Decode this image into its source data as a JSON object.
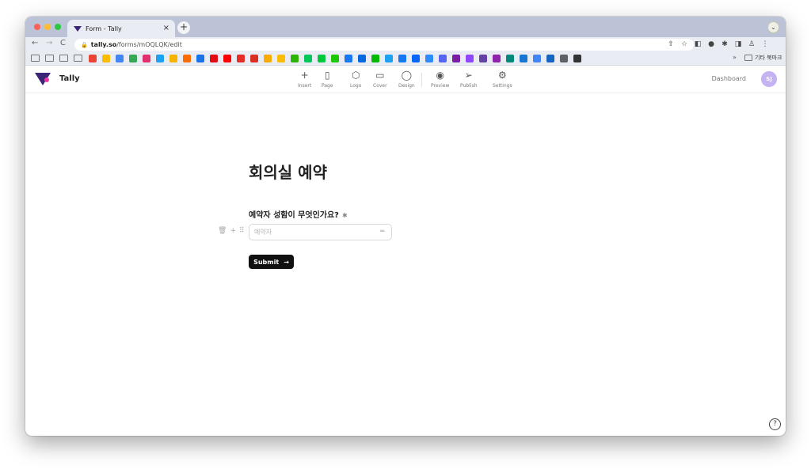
{
  "browser": {
    "tab": {
      "title": "Form - Tally",
      "close_glyph": "×"
    },
    "new_tab_glyph": "+",
    "profile_glyph": "⌄",
    "nav": {
      "back": "←",
      "forward": "→",
      "reload": "C"
    },
    "url": {
      "lock": "🔒",
      "domain": "tally.so",
      "path": "/forms/mOQLQK/edit"
    },
    "toolbar_icons": [
      {
        "name": "share-icon",
        "glyph": "⇧"
      },
      {
        "name": "bookmark-star-icon",
        "glyph": "☆"
      },
      {
        "name": "extension-icon",
        "glyph": "◧"
      },
      {
        "name": "extension-icon",
        "glyph": "●"
      },
      {
        "name": "puzzle-icon",
        "glyph": "✱"
      },
      {
        "name": "sidepanel-icon",
        "glyph": "◨"
      },
      {
        "name": "profile-icon",
        "glyph": "♙"
      },
      {
        "name": "menu-icon",
        "glyph": "⋮"
      }
    ],
    "bookmarks_more": "»",
    "bookmarks_other": "기타 북마크",
    "bookmark_colors": [
      "#ea4335",
      "#fbbc04",
      "#4285f4",
      "#34a853",
      "#e1306c",
      "#1da1f2",
      "#f4b400",
      "#ff6d00",
      "#1a73e8",
      "#e50914",
      "#ff0000",
      "#e52d27",
      "#d93025",
      "#f9ab00",
      "#fbbc04",
      "#2db400",
      "#03c75a",
      "#00c73c",
      "#1ec800",
      "#1877f2",
      "#0668e1",
      "#00b900",
      "#1da1f2",
      "#1877f2",
      "#0866ff",
      "#2d8cff",
      "#5865f2",
      "#7b1fa2",
      "#9146ff",
      "#6441a5",
      "#8e24aa",
      "#00897b",
      "#1976d2",
      "#4285f4",
      "#1565c0",
      "#5f6368",
      "#333333"
    ]
  },
  "app": {
    "brand": "Tally",
    "toolbar": [
      {
        "key": "insert",
        "icon": "plus-icon",
        "glyph": "+",
        "label": "Insert"
      },
      {
        "key": "page",
        "icon": "page-icon",
        "glyph": "▯",
        "label": "Page"
      },
      {
        "key": "logo",
        "icon": "hexagon-icon",
        "glyph": "⬡",
        "label": "Logo"
      },
      {
        "key": "cover",
        "icon": "cover-icon",
        "glyph": "▭",
        "label": "Cover"
      },
      {
        "key": "design",
        "icon": "drop-icon",
        "glyph": "◯",
        "label": "Design"
      },
      {
        "key": "preview",
        "icon": "eye-icon",
        "glyph": "◉",
        "label": "Preview"
      },
      {
        "key": "publish",
        "icon": "send-icon",
        "glyph": "➢",
        "label": "Publish"
      },
      {
        "key": "settings",
        "icon": "gear-icon",
        "glyph": "⚙",
        "label": "Settings"
      }
    ],
    "dashboard_label": "Dashboard",
    "avatar_initials": "SJ"
  },
  "form": {
    "title": "회의실 예약",
    "question": "예약자 성함이 무엇인가요?",
    "required_mark": "✱",
    "answer_placeholder": "예약자",
    "answer_value": "",
    "block_tool_glyphs": {
      "delete": "🗑",
      "add": "+",
      "drag": "⠿"
    },
    "input_handle_glyph": "═",
    "submit_label": "Submit",
    "submit_arrow": "→"
  },
  "help_glyph": "?"
}
